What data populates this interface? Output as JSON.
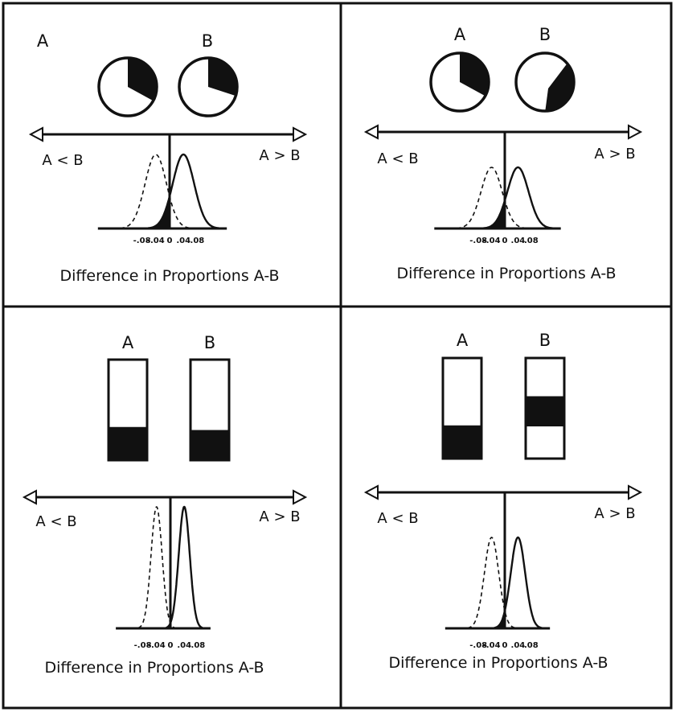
{
  "ink_color": "#111111",
  "paper_color": "#ffffff",
  "panels": [
    {
      "id": "top-left",
      "icon_type": "pie",
      "label_a": "A",
      "label_b": "B",
      "fraction_a": 0.33,
      "fraction_b": 0.3,
      "left_label": "A < B",
      "right_label": "A > B",
      "ticks": [
        "-.08",
        "-.04",
        "0",
        ".04",
        ".08"
      ],
      "xlabel": "Difference in Proportions A-B",
      "curve_spread": "wide"
    },
    {
      "id": "top-right",
      "icon_type": "pie",
      "label_a": "A",
      "label_b": "B",
      "fraction_a": 0.33,
      "fraction_b": 0.36,
      "left_label": "A < B",
      "right_label": "A > B",
      "ticks": [
        "-.08",
        "-.04",
        "0",
        ".04",
        ".08"
      ],
      "xlabel": "Difference in Proportions A-B",
      "curve_spread": "wide"
    },
    {
      "id": "bottom-left",
      "icon_type": "bar",
      "label_a": "A",
      "label_b": "B",
      "fraction_a": 0.33,
      "fraction_b": 0.3,
      "left_label": "A < B",
      "right_label": "A > B",
      "ticks": [
        "-.08",
        "-.04",
        "0",
        ".04",
        ".08"
      ],
      "xlabel": "Difference in Proportions A-B",
      "curve_spread": "narrow"
    },
    {
      "id": "bottom-right",
      "icon_type": "bar",
      "label_a": "A",
      "label_b": "B",
      "fraction_a": 0.33,
      "fraction_b": 0.3,
      "left_label": "A < B",
      "right_label": "A > B",
      "ticks": [
        "-.08",
        "-.04",
        "0",
        ".04",
        ".08"
      ],
      "xlabel": "Difference in Proportions A-B",
      "curve_spread": "medium"
    }
  ]
}
